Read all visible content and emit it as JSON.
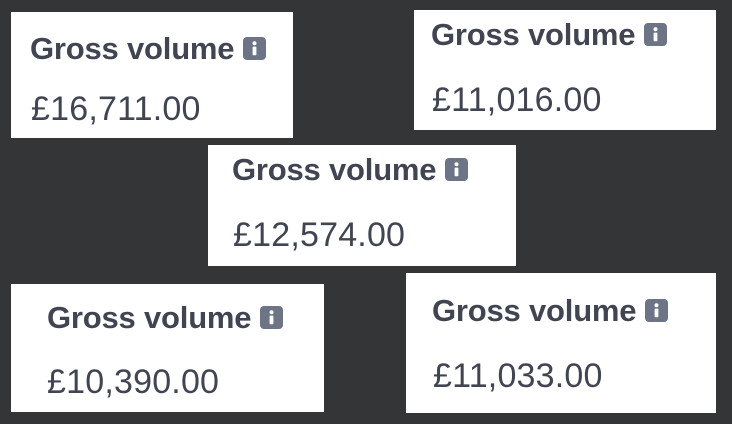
{
  "background_color": "#343536",
  "card_color": "#ffffff",
  "text_color": "#414552",
  "icon_color": "#6c7486",
  "cards": [
    {
      "label": "Gross volume",
      "icon": "info-icon",
      "value": "£16,711.00"
    },
    {
      "label": "Gross volume",
      "icon": "info-icon",
      "value": "£11,016.00"
    },
    {
      "label": "Gross volume",
      "icon": "info-icon",
      "value": "£12,574.00"
    },
    {
      "label": "Gross volume",
      "icon": "info-icon",
      "value": "£10,390.00"
    },
    {
      "label": "Gross volume",
      "icon": "info-icon",
      "value": "£11,033.00"
    }
  ]
}
